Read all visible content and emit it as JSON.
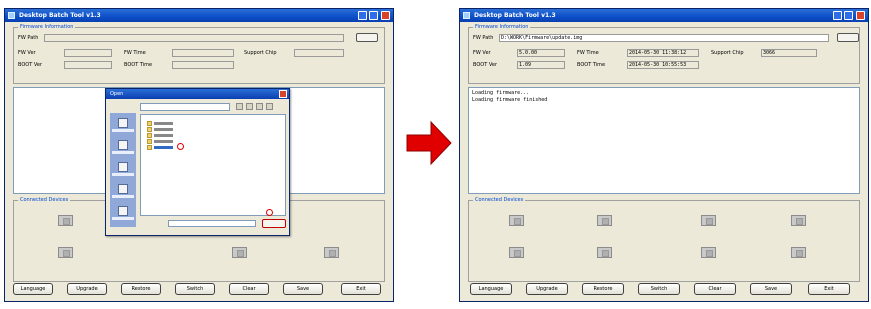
{
  "left_window": {
    "title": "Desktop Batch Tool v1.3",
    "group_firmware": "Firmware Information",
    "lbl_fw_path": "FW Path",
    "lbl_fw_ver": "FW Ver",
    "lbl_fw_time": "FW Time",
    "lbl_support_chip": "Support Chip",
    "lbl_boot_ver": "BOOT Ver",
    "lbl_boot_time": "BOOT Time",
    "group_devices": "Connected Devices",
    "buttons": [
      "Language",
      "Upgrade",
      "Restore",
      "Switch",
      "Clear",
      "Save",
      "Exit"
    ]
  },
  "right_window": {
    "title": "Desktop Batch Tool v1.3",
    "group_firmware": "Firmware Information",
    "lbl_fw_path": "FW Path",
    "lbl_fw_ver": "FW Ver",
    "lbl_fw_time": "FW Time",
    "lbl_support_chip": "Support Chip",
    "lbl_boot_ver": "BOOT Ver",
    "lbl_boot_time": "BOOT Time",
    "fw_path_value": "D:\\WORK\\Firmware\\update.img",
    "fw_ver_value": "5.0.00",
    "fw_time_value": "2014-05-30 11:38:12",
    "support_chip_value": "3066",
    "boot_ver_value": "1.09",
    "boot_time_value": "2014-05-30 10:55:53",
    "log_lines": [
      "Loading firmware...",
      "Loading firmware finished"
    ],
    "group_devices": "Connected Devices",
    "buttons": [
      "Language",
      "Upgrade",
      "Restore",
      "Switch",
      "Clear",
      "Save",
      "Exit"
    ]
  },
  "dialog": {
    "title": "Open"
  },
  "markers": {
    "m1": "1",
    "m2": "2"
  },
  "arrow_color": "#e00000"
}
